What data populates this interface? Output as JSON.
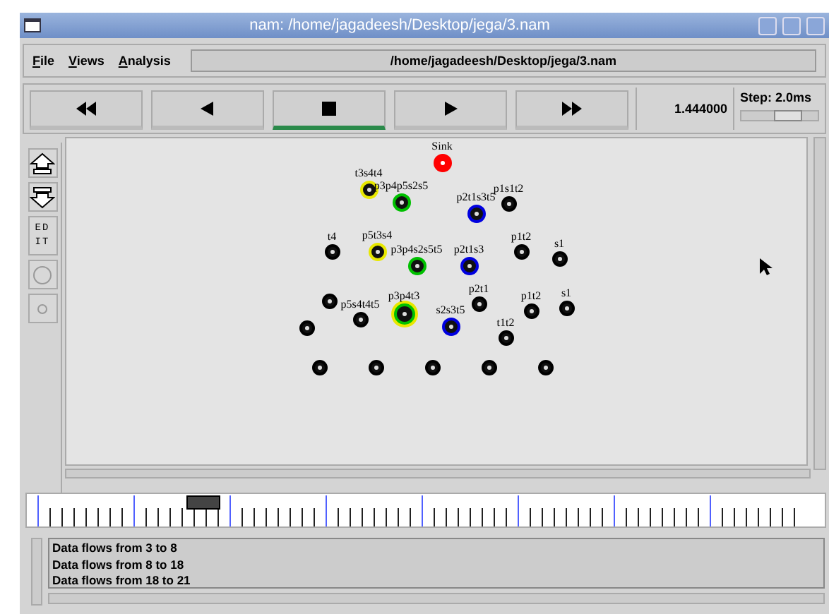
{
  "window": {
    "title": "nam: /home/jagadeesh/Desktop/jega/3.nam"
  },
  "menu": [
    "File",
    "Views",
    "Analysis"
  ],
  "file_path": "/home/jagadeesh/Desktop/jega/3.nam",
  "controls": [
    {
      "kind": "rewind",
      "selected": false
    },
    {
      "kind": "back",
      "selected": false
    },
    {
      "kind": "stop",
      "selected": true
    },
    {
      "kind": "play",
      "selected": false
    },
    {
      "kind": "forward",
      "selected": false
    }
  ],
  "time": "1.444000",
  "step": {
    "label": "Step: 2.0ms",
    "level": 0.62
  },
  "tools": [
    {
      "kind": "zoom-in"
    },
    {
      "kind": "zoom-out"
    },
    {
      "kind": "edit",
      "label": "EDIT"
    },
    {
      "kind": "circle"
    },
    {
      "kind": "dot"
    }
  ],
  "nodes": [
    {
      "label": "Sink",
      "color": "#ff0000",
      "filled": true
    },
    {
      "label": "t3s4t4",
      "color": "#e8e800",
      "filled": false
    },
    {
      "label": "p3p4p5s2s5",
      "color": "#00c000",
      "filled": false
    },
    {
      "label": "p1s1t2",
      "color": "#000000",
      "filled": false
    },
    {
      "label": "p2t1s3t5",
      "color": "#0000e0",
      "filled": false
    },
    {
      "label": "t4",
      "color": "#000000",
      "filled": false
    },
    {
      "label": "p5t3s4",
      "color": "#e8e800",
      "filled": false
    },
    {
      "label": "p3p4s2s5t5",
      "color": "#00c000",
      "filled": false
    },
    {
      "label": "p2t1s3",
      "color": "#0000e0",
      "filled": false
    },
    {
      "label": "p1t2",
      "color": "#000000",
      "filled": false
    },
    {
      "label": "s1",
      "color": "#000000",
      "filled": false
    },
    {
      "color": "#000000",
      "filled": false
    },
    {
      "label": "p5s4t4t5",
      "color": "#000000",
      "filled": false
    },
    {
      "color": "#000000",
      "filled": false
    },
    {
      "label": "p3p4t3",
      "color": "#00c000",
      "halo": {
        "color": "#e8e800"
      },
      "filled": false
    },
    {
      "label": "p2t1",
      "color": "#000000",
      "filled": false
    },
    {
      "label": "s2s3t5",
      "color": "#0000e0",
      "filled": false
    },
    {
      "label": "p1t2",
      "color": "#000000",
      "filled": false
    },
    {
      "label": "s1",
      "color": "#000000",
      "filled": false
    },
    {
      "label": "t1t2",
      "color": "#000000",
      "filled": false
    },
    {
      "color": "#000000",
      "filled": false
    },
    {
      "color": "#000000",
      "filled": false
    },
    {
      "color": "#000000",
      "filled": false
    },
    {
      "color": "#000000",
      "filled": false
    },
    {
      "color": "#000000",
      "filled": false
    }
  ],
  "log": [
    "Data flows from 3 to 8",
    "Data flows from 8 to 18",
    "Data flows from 18 to 21"
  ]
}
